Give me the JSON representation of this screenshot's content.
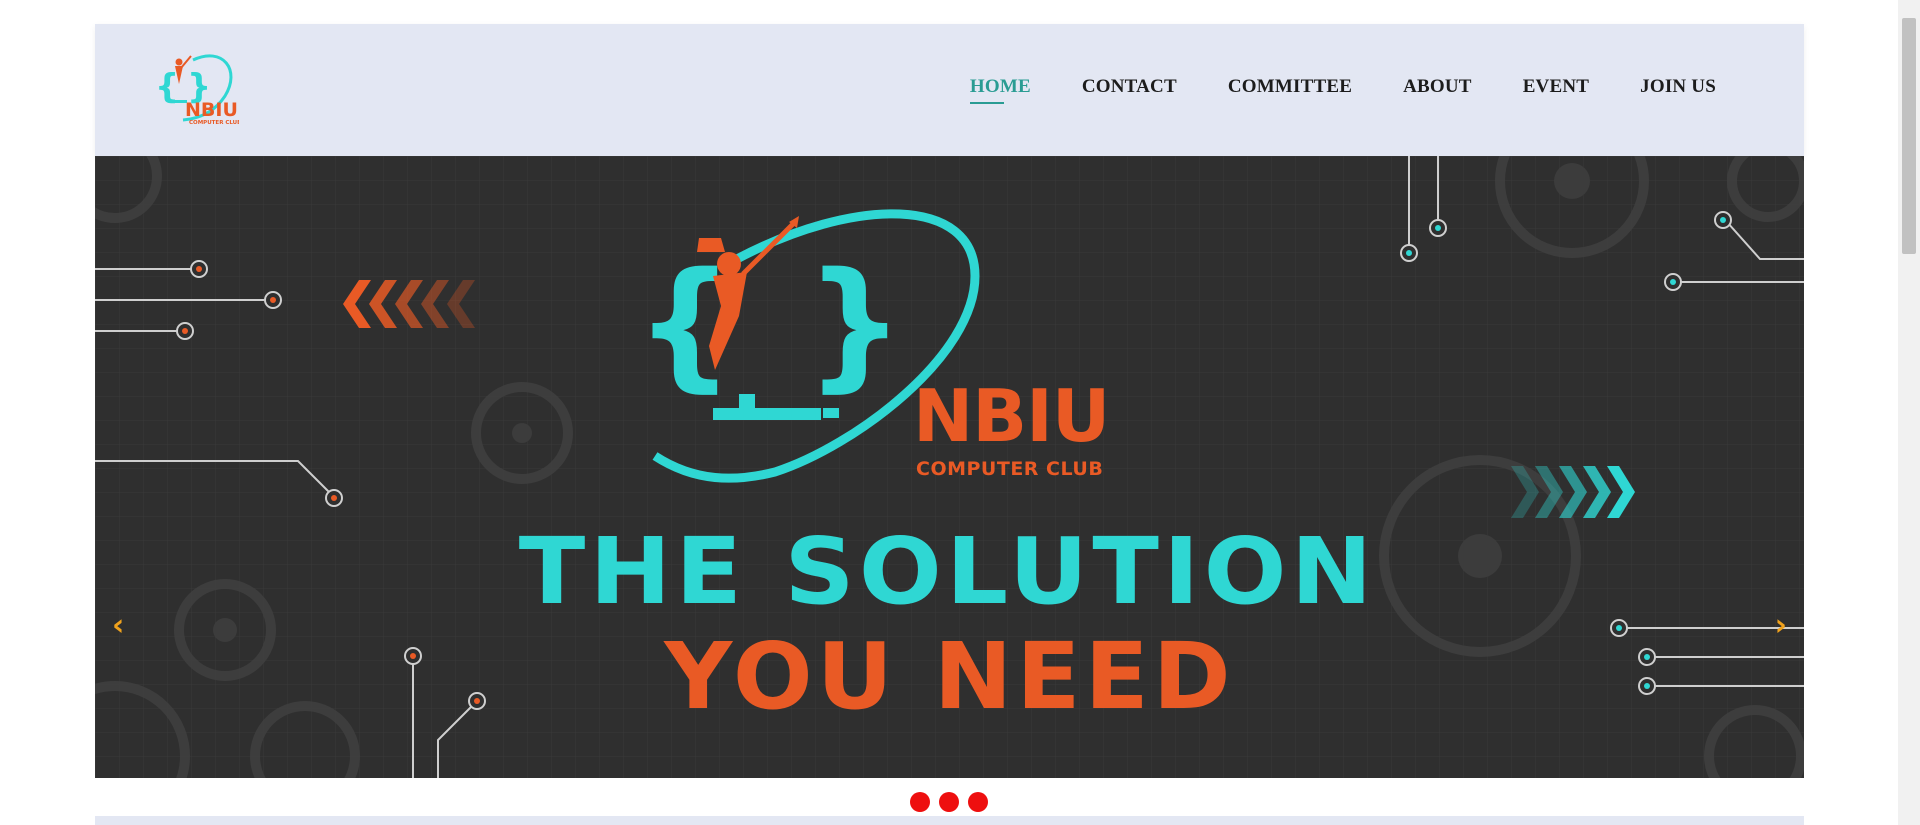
{
  "brand": {
    "logo_text": "NBIU",
    "logo_subtext": "COMPUTER CLUB",
    "teal": "#2fd7d3",
    "orange": "#e95a25"
  },
  "nav": {
    "items": [
      {
        "label": "HOME",
        "active": true
      },
      {
        "label": "CONTACT",
        "active": false
      },
      {
        "label": "COMMITTEE",
        "active": false
      },
      {
        "label": "ABOUT",
        "active": false
      },
      {
        "label": "EVENT",
        "active": false
      },
      {
        "label": "JOIN US",
        "active": false
      }
    ]
  },
  "hero": {
    "brand_name": "NBIU",
    "brand_sub": "COMPUTER CLUB",
    "headline_line1": "THE SOLUTION",
    "headline_line2": "YOU NEED",
    "prev_icon": "‹",
    "next_icon": "›"
  },
  "slider": {
    "slide_count": 3,
    "indicator_color": "#ee0f0f"
  }
}
